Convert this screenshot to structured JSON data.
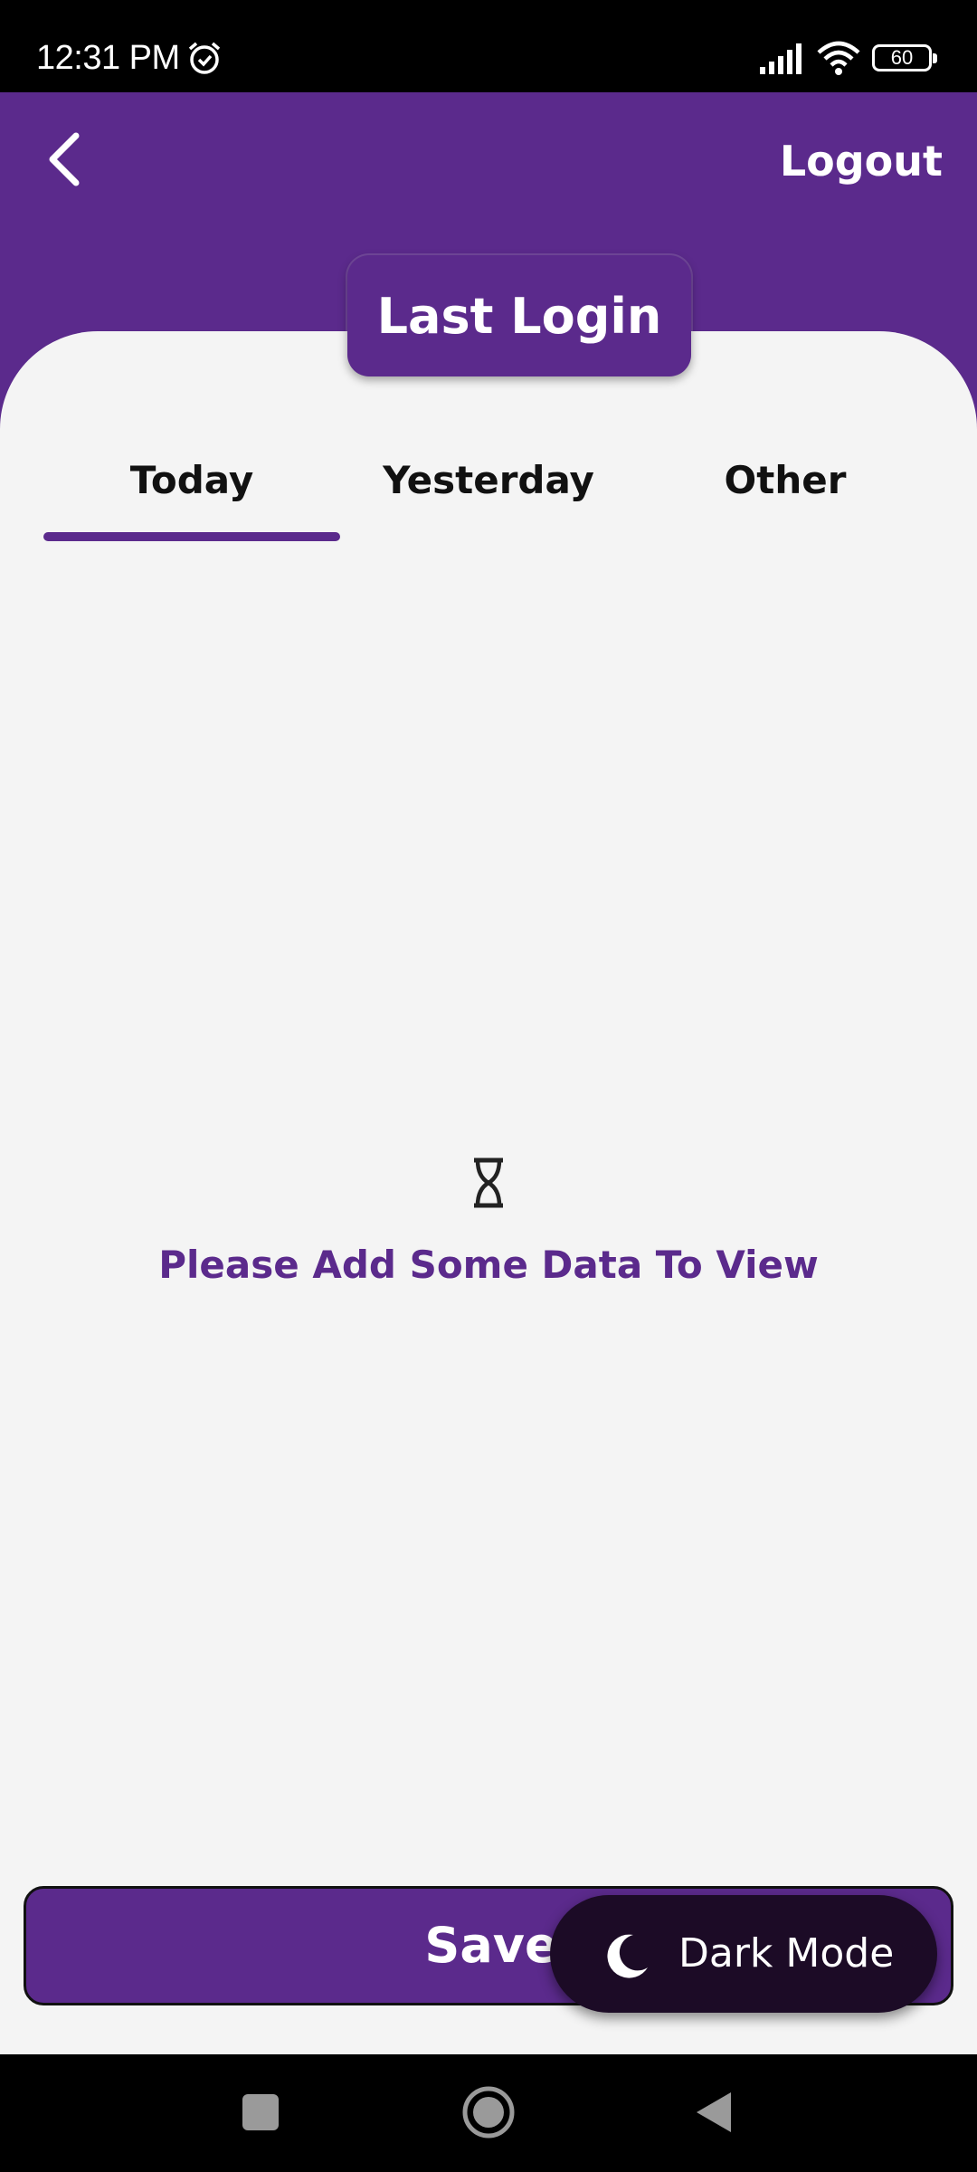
{
  "status_bar": {
    "time": "12:31 PM",
    "battery_level": "60",
    "icons": [
      "alarm-icon",
      "signal-icon",
      "wifi-icon",
      "battery-icon"
    ]
  },
  "header": {
    "back_icon": "chevron-left-icon",
    "logout_label": "Logout",
    "title": "Last Login"
  },
  "tabs": [
    {
      "label": "Today",
      "selected": true
    },
    {
      "label": "Yesterday",
      "selected": false
    },
    {
      "label": "Other",
      "selected": false
    }
  ],
  "empty_state": {
    "icon": "hourglass-icon",
    "message": "Please Add Some Data To View"
  },
  "save_button": {
    "label": "Save"
  },
  "dark_mode_button": {
    "icon": "moon-icon",
    "label": "Dark Mode"
  },
  "nav_bar": {
    "icons": [
      "recents-icon",
      "home-icon",
      "back-icon"
    ]
  },
  "colors": {
    "primary": "#5b2a8c",
    "background": "#f4f4f4",
    "fab": "#1c0b26"
  }
}
